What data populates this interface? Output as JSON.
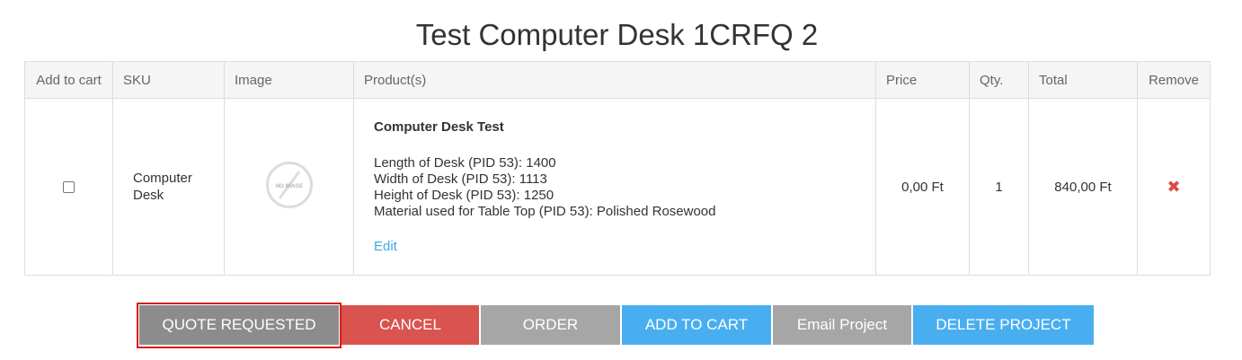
{
  "page": {
    "title": "Test Computer Desk 1CRFQ 2"
  },
  "table": {
    "headers": {
      "add_to_cart": "Add to cart",
      "sku": "SKU",
      "image": "Image",
      "products": "Product(s)",
      "price": "Price",
      "qty": "Qty.",
      "total": "Total",
      "remove": "Remove"
    },
    "rows": [
      {
        "add_to_cart_checked": false,
        "sku_line1": "Computer",
        "sku_line2": "Desk",
        "image_icon": "no-image-icon",
        "image_text": "NO IMAGE",
        "product_name": "Computer Desk Test",
        "attributes": [
          "Length of Desk (PID 53): 1400",
          "Width of Desk (PID 53): 1113",
          "Height of Desk (PID 53): 1250",
          "Material used for Table Top (PID 53): Polished Rosewood"
        ],
        "edit_label": "Edit",
        "price": "0,00 Ft",
        "qty": "1",
        "total": "840,00 Ft",
        "remove_icon": "close-icon",
        "remove_glyph": "✖"
      }
    ]
  },
  "actions": {
    "quote_requested": "QUOTE REQUESTED",
    "cancel": "CANCEL",
    "order": "ORDER",
    "add_to_cart": "ADD TO CART",
    "email_project": "Email Project",
    "delete_project": "DELETE PROJECT"
  },
  "colors": {
    "accent_blue": "#48aef0",
    "cancel_red": "#d9534f",
    "gray_button": "#a6a6a6",
    "quote_gray": "#8c8c8c",
    "highlight_red": "#d91c1c",
    "link_blue": "#3fa9e4"
  }
}
